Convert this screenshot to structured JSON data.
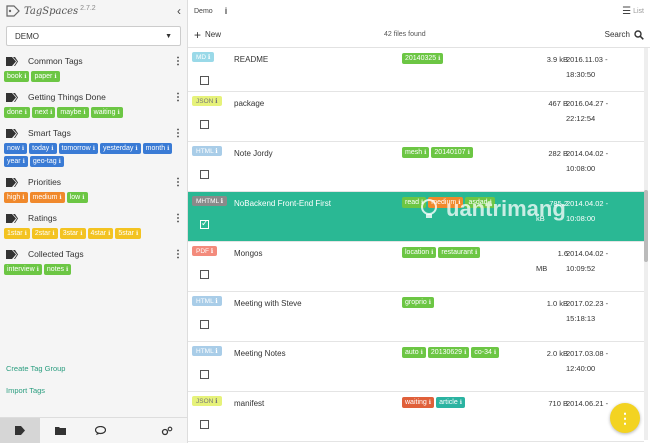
{
  "app": {
    "name": "TagSpaces",
    "version": "2.7.2"
  },
  "colors": {
    "accent": "#2ab894",
    "green": "#6cc644",
    "blue": "#3a7bd5",
    "orange": "#f0892c",
    "yellow": "#f3c321"
  },
  "sidebar": {
    "location": "DEMO",
    "groups": [
      {
        "title": "Common Tags",
        "tags": [
          {
            "label": "book",
            "color": "green"
          },
          {
            "label": "paper",
            "color": "green"
          }
        ]
      },
      {
        "title": "Getting Things Done",
        "tags": [
          {
            "label": "done",
            "color": "green"
          },
          {
            "label": "next",
            "color": "green"
          },
          {
            "label": "maybe",
            "color": "green"
          },
          {
            "label": "waiting",
            "color": "green"
          }
        ]
      },
      {
        "title": "Smart Tags",
        "tags": [
          {
            "label": "now",
            "color": "blue"
          },
          {
            "label": "today",
            "color": "blue"
          },
          {
            "label": "tomorrow",
            "color": "blue"
          },
          {
            "label": "yesterday",
            "color": "blue"
          },
          {
            "label": "month",
            "color": "blue"
          },
          {
            "label": "year",
            "color": "blue"
          },
          {
            "label": "geo-tag",
            "color": "blue"
          }
        ]
      },
      {
        "title": "Priorities",
        "tags": [
          {
            "label": "high",
            "color": "orange"
          },
          {
            "label": "medium",
            "color": "orange"
          },
          {
            "label": "low",
            "color": "green"
          }
        ]
      },
      {
        "title": "Ratings",
        "tags": [
          {
            "label": "1star",
            "color": "yellow"
          },
          {
            "label": "2star",
            "color": "yellow"
          },
          {
            "label": "3star",
            "color": "yellow"
          },
          {
            "label": "4star",
            "color": "yellow"
          },
          {
            "label": "5star",
            "color": "yellow"
          }
        ]
      },
      {
        "title": "Collected Tags",
        "tags": [
          {
            "label": "interview",
            "color": "green"
          },
          {
            "label": "notes",
            "color": "green"
          }
        ]
      }
    ],
    "create_group": "Create Tag Group",
    "import_tags": "Import Tags"
  },
  "topbar": {
    "location": "Demo",
    "view_label": "List"
  },
  "actionbar": {
    "new_label": "New",
    "found": "42 files found",
    "search_label": "Search"
  },
  "files": [
    {
      "ext": "MD",
      "ext_class": "md",
      "name": "README",
      "tags": [
        {
          "label": "20140325",
          "color": "green"
        }
      ],
      "size": "3.9 kB",
      "date": "2016.11.03 -",
      "time": "18:30:50",
      "selected": false
    },
    {
      "ext": "JSON",
      "ext_class": "json",
      "name": "package",
      "tags": [],
      "size": "467 B",
      "date": "2016.04.27 -",
      "time": "22:12:54",
      "selected": false
    },
    {
      "ext": "HTML",
      "ext_class": "html",
      "name": "Note Jordy",
      "tags": [
        {
          "label": "mesh",
          "color": "green"
        },
        {
          "label": "20140107",
          "color": "green"
        }
      ],
      "size": "282 B",
      "date": "2014.04.02 -",
      "time": "10:08:00",
      "selected": false
    },
    {
      "ext": "MHTML",
      "ext_class": "mhtml",
      "name": "NoBackend Front-End First",
      "tags": [
        {
          "label": "read",
          "color": "green"
        },
        {
          "label": "medium",
          "color": "orange"
        },
        {
          "label": "asdad",
          "color": "green"
        }
      ],
      "size": "785.2",
      "size2": "kB",
      "date": "2014.04.02 -",
      "time": "10:08:00",
      "selected": true
    },
    {
      "ext": "PDF",
      "ext_class": "pdf",
      "name": "Mongos",
      "tags": [
        {
          "label": "location",
          "color": "green"
        },
        {
          "label": "restaurant",
          "color": "green"
        }
      ],
      "size": "1.6",
      "size2": "MB",
      "date": "2014.04.02 -",
      "time": "10:09:52",
      "selected": false
    },
    {
      "ext": "HTML",
      "ext_class": "html",
      "name": "Meeting with Steve",
      "tags": [
        {
          "label": "groprio",
          "color": "green"
        }
      ],
      "size": "1.0 kB",
      "date": "2017.02.23 -",
      "time": "15:18:13",
      "selected": false
    },
    {
      "ext": "HTML",
      "ext_class": "html",
      "name": "Meeting Notes",
      "tags": [
        {
          "label": "auto",
          "color": "green"
        },
        {
          "label": "20130629",
          "color": "green"
        },
        {
          "label": "co-34",
          "color": "green"
        }
      ],
      "size": "2.0 kB",
      "date": "2017.03.08 -",
      "time": "12:40:00",
      "selected": false
    },
    {
      "ext": "JSON",
      "ext_class": "json",
      "name": "manifest",
      "tags": [
        {
          "label": "waiting",
          "color": "red"
        },
        {
          "label": "article",
          "color": "teal"
        }
      ],
      "size": "710 B",
      "date": "2014.06.21 -",
      "time": "",
      "selected": false
    }
  ],
  "watermark": "uantrimang",
  "fab_label": "⋮"
}
